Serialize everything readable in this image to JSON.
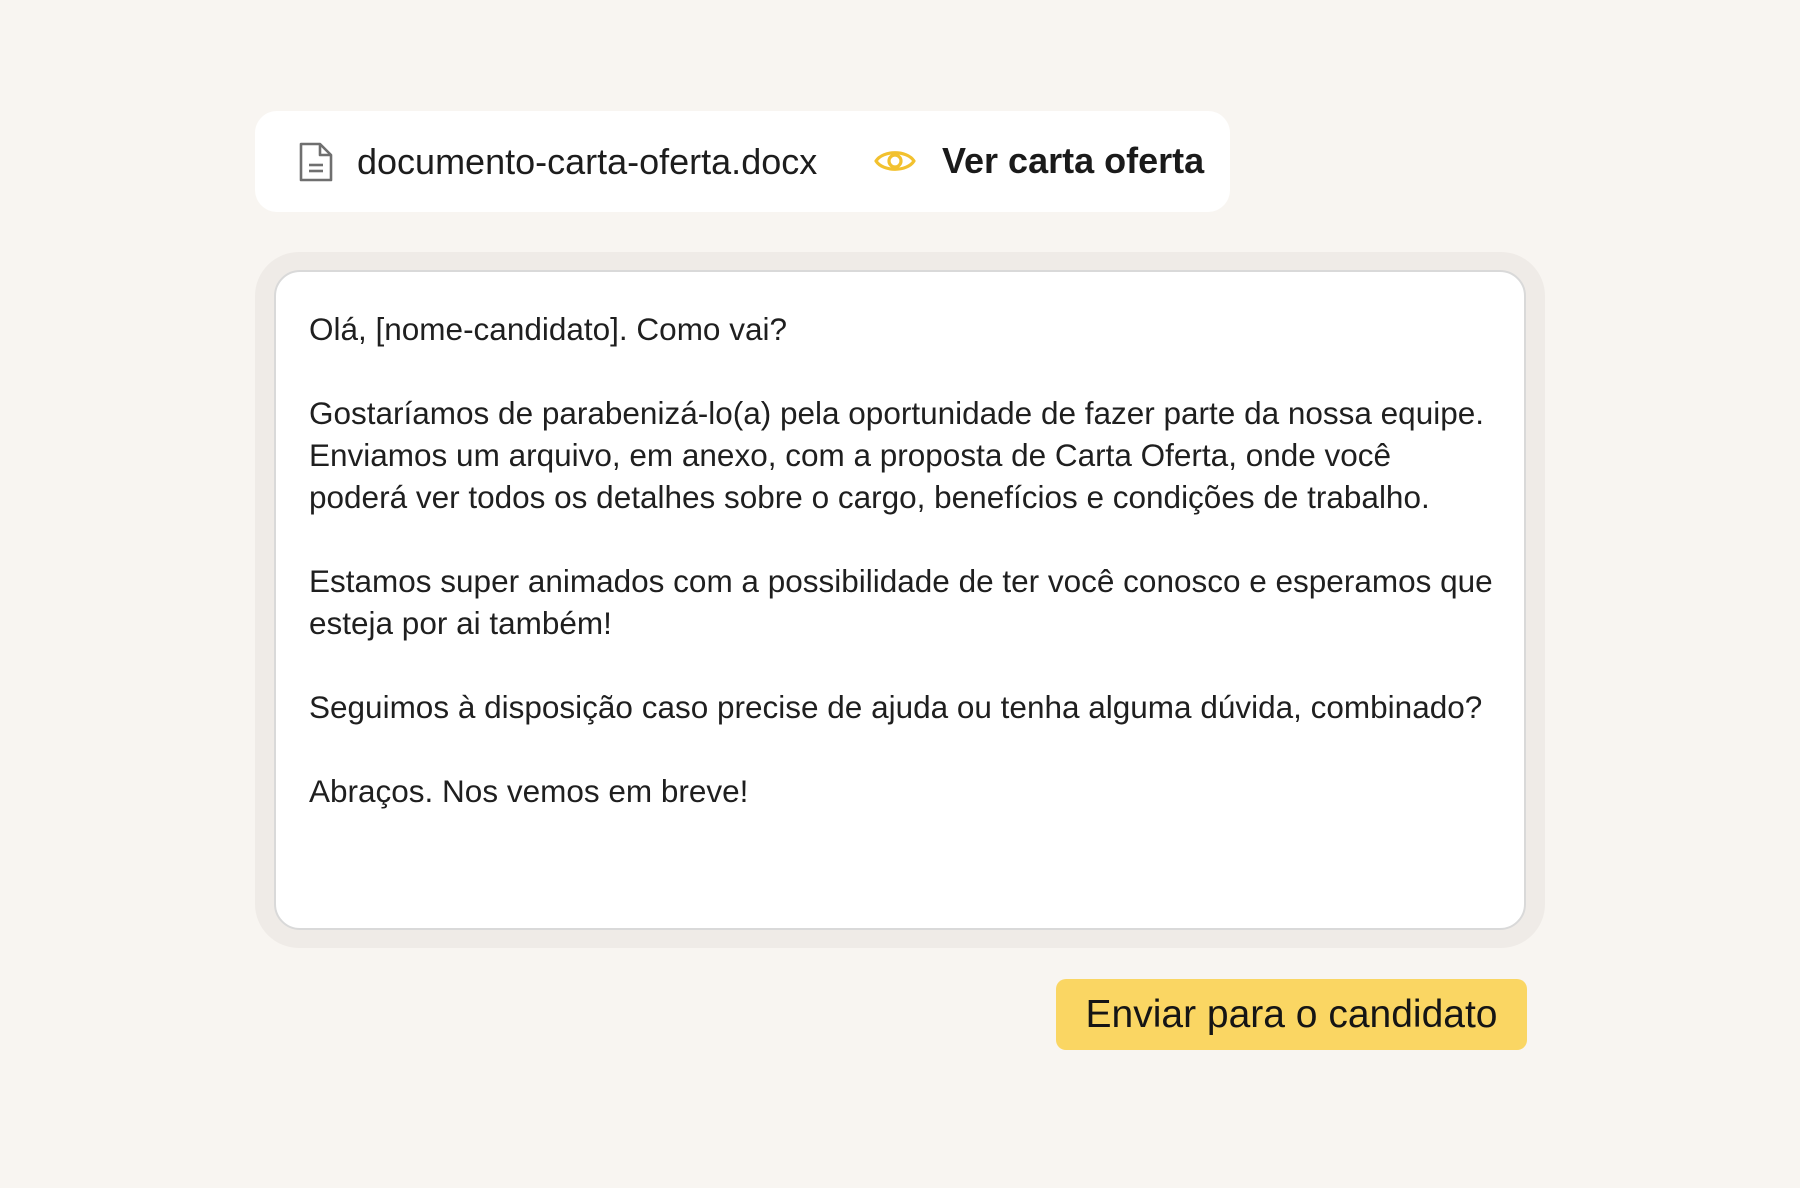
{
  "attachment": {
    "file_icon": "document-icon",
    "file_name": "documento-carta-oferta.docx",
    "view_icon": "eye-icon",
    "view_label": "Ver carta oferta",
    "accent_color": "#f2c12e"
  },
  "message": {
    "greeting": "Olá, [nome-candidato]. Como vai?",
    "paragraph_1": "Gostaríamos de parabenizá-lo(a) pela oportunidade de fazer parte da nossa equipe. Enviamos um arquivo, em anexo, com a proposta de Carta Oferta, onde você poderá ver todos os detalhes sobre o cargo, benefícios e condições de trabalho.",
    "paragraph_2": "Estamos super animados com a possibilidade de ter você conosco e esperamos que esteja por ai também!",
    "paragraph_3": "Seguimos à disposição caso precise de ajuda ou tenha alguma dúvida, combinado?",
    "closing": "Abraços. Nos vemos em breve!"
  },
  "actions": {
    "send_label": "Enviar para o candidato",
    "send_color": "#fad663"
  }
}
